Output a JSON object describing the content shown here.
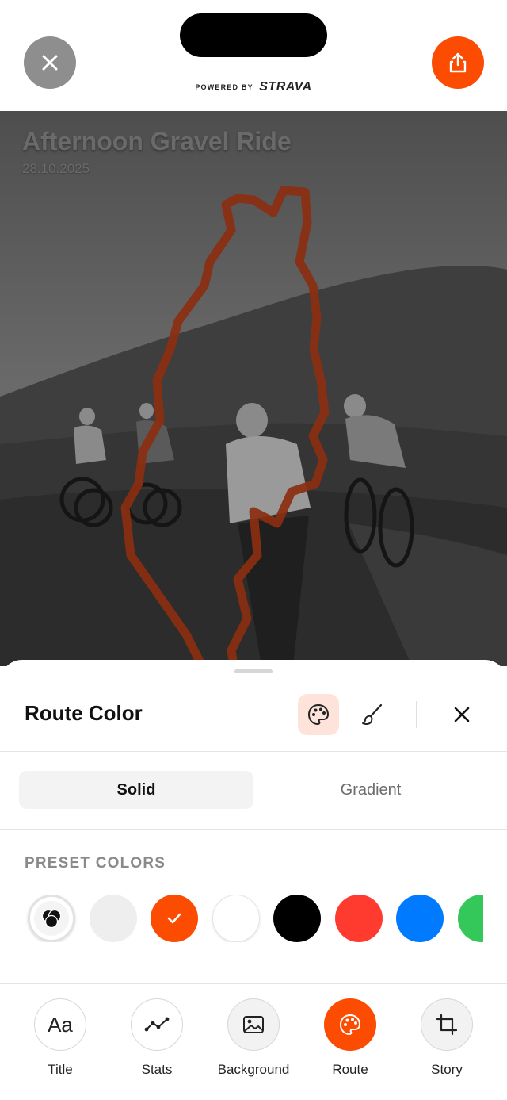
{
  "header": {
    "powered_prefix": "POWERED BY",
    "brand": "STRAVA",
    "close_icon": "close-icon",
    "share_icon": "share-icon"
  },
  "activity": {
    "title": "Afternoon Gravel Ride",
    "date": "28.10.2025"
  },
  "sheet": {
    "title": "Route Color",
    "tools": [
      "palette-icon",
      "brush-icon"
    ],
    "close_icon": "close-icon"
  },
  "mode": {
    "options": [
      "Solid",
      "Gradient"
    ],
    "selected": "Solid"
  },
  "presets": {
    "label": "PRESET COLORS",
    "colors": [
      {
        "name": "custom",
        "hex": "multicolor"
      },
      {
        "name": "light-gray",
        "hex": "#eeeeee"
      },
      {
        "name": "strava-orange",
        "hex": "#fc4c02",
        "selected": true
      },
      {
        "name": "white",
        "hex": "#ffffff"
      },
      {
        "name": "black",
        "hex": "#000000"
      },
      {
        "name": "red",
        "hex": "#ff3b30"
      },
      {
        "name": "blue",
        "hex": "#007aff"
      },
      {
        "name": "green",
        "hex": "#34c759"
      }
    ]
  },
  "toolbar": {
    "items": [
      {
        "label": "Title",
        "icon": "text-icon"
      },
      {
        "label": "Stats",
        "icon": "stats-icon"
      },
      {
        "label": "Background",
        "icon": "image-icon"
      },
      {
        "label": "Route",
        "icon": "palette-icon",
        "active": true
      },
      {
        "label": "Story",
        "icon": "crop-icon"
      }
    ]
  },
  "colors": {
    "accent": "#fc4c02",
    "route": "#8b2e10"
  }
}
